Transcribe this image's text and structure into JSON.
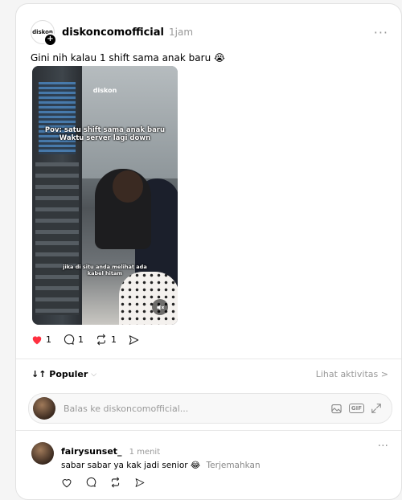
{
  "post": {
    "username": "diskoncomofficial",
    "time": "1jam",
    "more": "···",
    "caption": "Gini nih kalau 1 shift sama anak baru 😭",
    "avatar_logo_text": "diskon",
    "video": {
      "logo_text": "diskon",
      "overlay_line1": "Pov: satu shift sama anak baru",
      "overlay_line2": "Waktu server lagi down",
      "overlay_bottom_line1": "jika di situ anda melihat ada",
      "overlay_bottom_line2": "kabel hitam"
    },
    "actions": {
      "like_count": "1",
      "comment_count": "1",
      "repost_count": "1"
    }
  },
  "sort": {
    "label": "↓↑ Populer",
    "chevron": "⌵",
    "activity": "Lihat aktivitas >"
  },
  "reply": {
    "placeholder": "Balas ke diskoncomofficial..."
  },
  "comment": {
    "username": "fairysunset_",
    "time": "1 menit",
    "more": "···",
    "text": "sabar sabar ya kak jadi senior 😂",
    "translate": "Terjemahkan"
  },
  "colors": {
    "like": "#ff3040",
    "muted": "#999999",
    "brand_accent": "#f2a900"
  }
}
